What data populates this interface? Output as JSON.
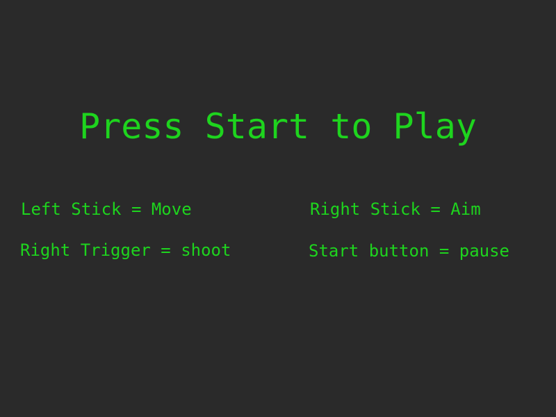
{
  "title": "Press Start to Play",
  "controls": [
    {
      "text": "Left Stick = Move"
    },
    {
      "text": "Right Stick = Aim"
    },
    {
      "text": "Right Trigger = shoot"
    },
    {
      "text": "Start button = pause"
    }
  ],
  "colors": {
    "background": "#2a2a2a",
    "text": "#1ed41e"
  }
}
